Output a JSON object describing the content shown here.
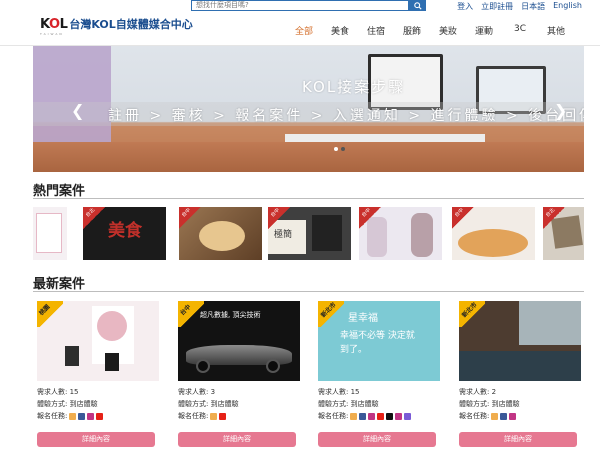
{
  "topbar": {
    "search_placeholder": "想找什麼項目嗎?",
    "links": [
      "登入",
      "立即註冊",
      "日本語",
      "English"
    ]
  },
  "header": {
    "logo_mark": "KOL",
    "logo_sub": "TAIWAN",
    "site_title": "台灣KOL自媒體媒合中心",
    "nav": [
      "全部",
      "美食",
      "住宿",
      "服飾",
      "美妝",
      "運動",
      "3C",
      "其他"
    ],
    "active_nav": "全部"
  },
  "banner": {
    "headline": "KOL接案步驟",
    "steps": "註冊 > 審核 > 報名案件 > 入選通知 > 進行體驗 > 後台回傳",
    "slides": 2,
    "active_slide": 2
  },
  "hot_section": {
    "title": "熱門案件",
    "items": [
      {
        "tag": "",
        "theme": "#f5f0f3"
      },
      {
        "tag": "台北",
        "theme": "#1b1b1b",
        "text": "美食"
      },
      {
        "tag": "台中",
        "theme": "#8a6a4a"
      },
      {
        "tag": "台中",
        "theme": "#e8e4dd",
        "text": "極簡"
      },
      {
        "tag": "台中",
        "theme": "#dcd6e6"
      },
      {
        "tag": "台中",
        "theme": "#f2ece6"
      },
      {
        "tag": "台中",
        "theme": "#e3b97f"
      },
      {
        "tag": "台北",
        "theme": "#d6cfc4"
      }
    ]
  },
  "new_section": {
    "title": "最新案件",
    "cards": [
      {
        "badge": "桃園",
        "need": "需求人數: 15",
        "method": "體驗方式: 到店體驗",
        "signup": "報名任務:",
        "button": "詳細內容",
        "thumb_text": "",
        "accent": "#f7eff0"
      },
      {
        "badge": "台中",
        "need": "需求人數: 3",
        "method": "體驗方式: 到店體驗",
        "signup": "報名任務:",
        "button": "詳細內容",
        "thumb_text": "超凡數據, 頂尖技術",
        "accent": "#1a1a1a"
      },
      {
        "badge": "新北市",
        "need": "需求人數: 15",
        "method": "體驗方式: 到店體驗",
        "signup": "報名任務:",
        "button": "詳細內容",
        "thumb_text": "幸福不必等 決定就到了。",
        "accent": "#79c8d3"
      },
      {
        "badge": "新北市",
        "need": "需求人數: 2",
        "method": "體驗方式: 到店體驗",
        "signup": "報名任務:",
        "button": "詳細內容",
        "thumb_text": "",
        "accent": "#4d3c30"
      }
    ],
    "card_brand": "星幸福"
  },
  "colors": {
    "brand_blue": "#1a4d8f",
    "nav_active": "#d4702d",
    "button_pink": "#e67891",
    "badge_yellow": "#f4b400",
    "tag_red": "#c9302c"
  }
}
